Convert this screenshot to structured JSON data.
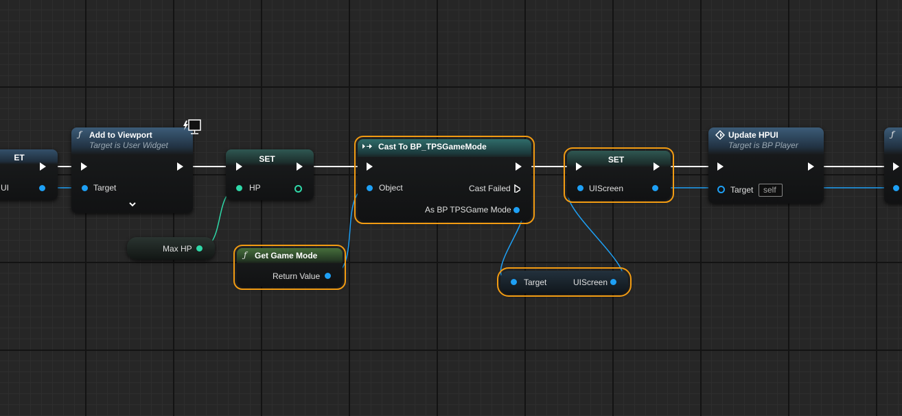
{
  "colors": {
    "accent_selection": "#f39c12",
    "object_pin": "#1ea0f5",
    "int_pin": "#2fd8a8",
    "exec_wire": "#ffffff"
  },
  "nodes": {
    "partial_left": {
      "header": "ET",
      "pin_label": "UI"
    },
    "add_to_viewport": {
      "title": "Add to Viewport",
      "subtitle": "Target is User Widget",
      "target_label": "Target",
      "expand_icon": "chevron-down-icon",
      "platform_icon": "monitor-icon"
    },
    "set_hp": {
      "title": "SET",
      "pin_label": "HP"
    },
    "max_hp": {
      "label": "Max HP"
    },
    "get_game_mode": {
      "title": "Get Game Mode",
      "output_label": "Return Value"
    },
    "cast": {
      "title": "Cast To BP_TPSGameMode",
      "object_label": "Object",
      "cast_failed_label": "Cast Failed",
      "as_label": "As BP TPSGame Mode"
    },
    "set_uiscreen": {
      "title": "SET",
      "pin_label": "UIScreen"
    },
    "get_uiscreen": {
      "target_label": "Target",
      "output_label": "UIScreen"
    },
    "update_hpui": {
      "title": "Update HPUI",
      "subtitle": "Target is BP Player",
      "target_label": "Target",
      "target_value": "self"
    }
  }
}
